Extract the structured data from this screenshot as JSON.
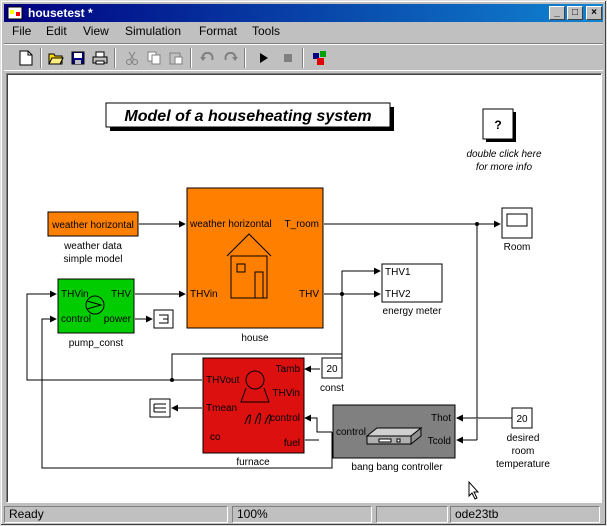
{
  "window": {
    "title": "housetest *"
  },
  "menu": {
    "file": "File",
    "edit": "Edit",
    "view": "View",
    "simulation": "Simulation",
    "format": "Format",
    "tools": "Tools"
  },
  "model": {
    "title": "Model of a househeating system",
    "info_block": {
      "symbol": "?",
      "line1": "double click here",
      "line2": "for more info"
    },
    "weather": {
      "port": "weather  horizontal",
      "label1": "weather data",
      "label2": "simple model"
    },
    "house": {
      "in_weather": "weather  horizontal",
      "in_thv": "THVin",
      "out_troom": "T_room",
      "out_thv": "THV",
      "label": "house"
    },
    "room_scope": {
      "label": "Room"
    },
    "energy_meter": {
      "in1": "THV1",
      "in2": "THV2",
      "label": "energy meter"
    },
    "pump": {
      "in_thv": "THVin",
      "in_control": "control",
      "out_thv": "THV",
      "out_power": "power",
      "label": "pump_const"
    },
    "furnace": {
      "in_tamb": "Tamb",
      "in_thvin": "THVin",
      "in_control": "control",
      "out_thvout": "THVout",
      "out_tmean": "Tmean",
      "out_co": "co",
      "out_fuel": "fuel",
      "label": "furnace"
    },
    "const_block": {
      "value": "20",
      "label": "const"
    },
    "setpoint": {
      "value": "20",
      "label1": "desired",
      "label2": "room",
      "label3": "temperature"
    },
    "controller": {
      "in_control": "control",
      "in_thot": "Thot",
      "in_tcold": "Tcold",
      "label": "bang bang controller"
    }
  },
  "status": {
    "state": "Ready",
    "zoom": "100%",
    "solver": "ode23tb"
  },
  "colors": {
    "orange": "#ff8000",
    "green": "#00cc00",
    "red": "#dd1010",
    "gray": "#808080"
  }
}
